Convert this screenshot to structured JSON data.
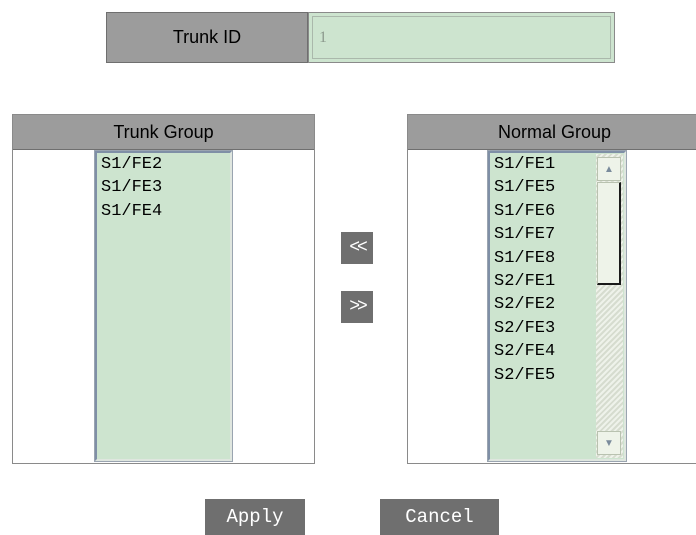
{
  "trunk_id": {
    "label": "Trunk ID",
    "value": "1"
  },
  "trunk_group": {
    "title": "Trunk Group",
    "ports": [
      "S1/FE2",
      "S1/FE3",
      "S1/FE4"
    ]
  },
  "normal_group": {
    "title": "Normal Group",
    "ports": [
      "S1/FE1",
      "S1/FE5",
      "S1/FE6",
      "S1/FE7",
      "S1/FE8",
      "S2/FE1",
      "S2/FE2",
      "S2/FE3",
      "S2/FE4",
      "S2/FE5"
    ]
  },
  "move": {
    "add_label": "<<",
    "remove_label": ">>"
  },
  "actions": {
    "apply_label": "Apply",
    "cancel_label": "Cancel"
  },
  "icons": {
    "scroll_up": "arrow-up-icon",
    "scroll_down": "arrow-down-icon"
  },
  "colors": {
    "header_gray": "#9c9c9c",
    "button_gray": "#6f6f6f",
    "field_green": "#cde4cf"
  }
}
